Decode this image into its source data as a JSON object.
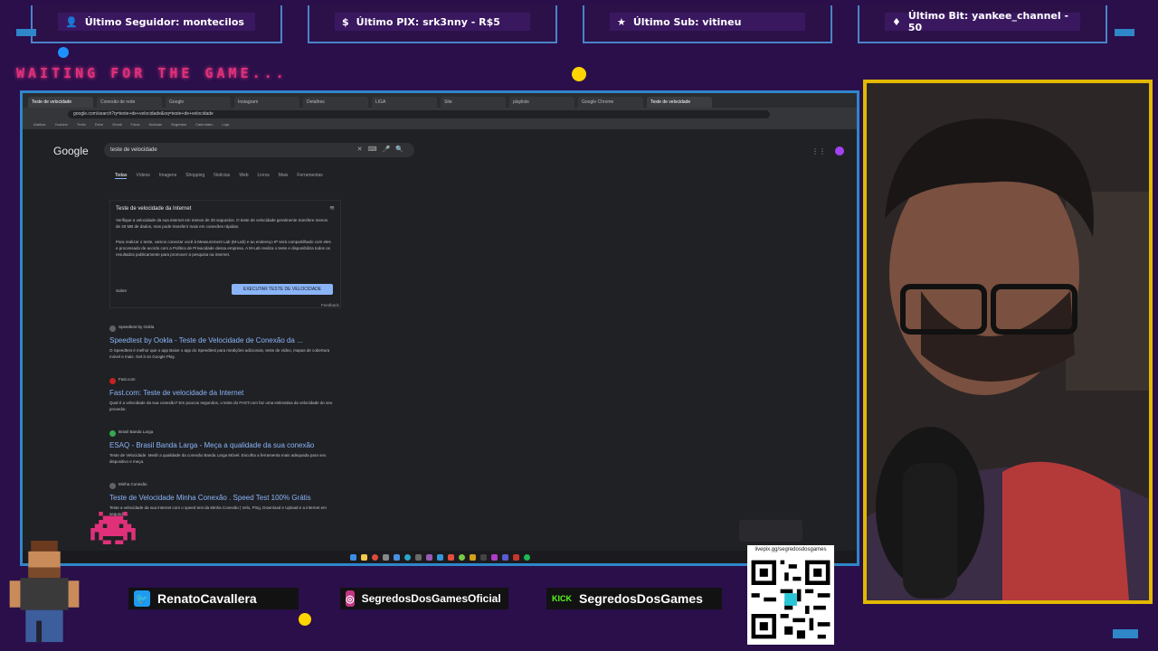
{
  "top_bars": [
    {
      "icon": "user-icon",
      "text": "Último Seguidor: montecilos"
    },
    {
      "icon": "dollar-icon",
      "text": "Último PIX: srk3nny - R$5"
    },
    {
      "icon": "star-icon",
      "text": "Último Sub: vitineu"
    },
    {
      "icon": "diamond-icon",
      "text": "Último Bit: yankee_channel - 50"
    }
  ],
  "overlay_text": "WAITING FOR THE GAME...",
  "browser": {
    "tabs": [
      "Teste de velocidade",
      "Conexão de rede",
      "Google",
      "Instagram",
      "Detalhes",
      "LIGA",
      "Site",
      "playlists",
      "Google Chrome",
      "Teste de velocidade"
    ],
    "url": "google.com/search?q=teste+de+velocidade&oq=teste+de+velocidade",
    "bookmarks": [
      "Atalhos",
      "Youtube",
      "Trello",
      "Drive",
      "Gmail",
      "Fotos",
      "Notícias",
      "Segredos",
      "Calendário",
      "Loja"
    ],
    "google_logo": "Google",
    "query": "teste de velocidade",
    "filters": [
      "Todas",
      "Vídeos",
      "Imagens",
      "Shopping",
      "Notícias",
      "Web",
      "Livros",
      "Mais",
      "Ferramentas"
    ],
    "speedtest": {
      "title": "Teste de velocidade da Internet",
      "p1": "Verifique a velocidade da sua internet em menos de 30 segundos. O teste de velocidade geralmente transfere menos de 40 MB de dados, mas pode transferir mais em conexões rápidas.",
      "p2": "Para realizar o teste, vamos conectar você à Measurement Lab (M-Lab) e ao endereço IP será compartilhado com eles e processado de acordo com a Política de Privacidade dessa empresa. A M-Lab realiza o teste e disponibiliza todos os resultados publicamente para promover a pesquisa na internet.",
      "about": "Sobre",
      "button": "EXECUTAR TESTE DE VELOCIDADE",
      "feedback": "Feedback"
    },
    "results": [
      {
        "site": "Speedtest by Ookla",
        "title": "Speedtest by Ookla - Teste de Velocidade de Conexão da ...",
        "snippet": "O Speedtest é melhor que o app Baixe o app do Speedtest para medições adicionais, teste de vídeo, mapas de cobertura móvel e mais. Get it on Google Play."
      },
      {
        "site": "Fast.com",
        "title": "Fast.com: Teste de velocidade da Internet",
        "snippet": "Qual é a velocidade da sua conexão? Em poucos segundos, o teste do FAST.com faz uma estimativa da velocidade do seu provedor."
      },
      {
        "site": "Brasil Banda Larga",
        "title": "ESAQ - Brasil Banda Larga - Meça a qualidade da sua conexão",
        "snippet": "Teste de Velocidade. Medir a qualidade da conexão Banda Larga Móvel. Escolha a ferramenta mais adequada para seu dispositivo e meça."
      },
      {
        "site": "Minha Conexão",
        "title": "Teste de Velocidade Minha Conexão . Speed Test 100% Grátis",
        "snippet": "Teste a velocidade da sua internet com o speed test da Minha Conexão | Velo, Ping, Download e Upload e a internet em segundos."
      }
    ]
  },
  "social": [
    {
      "icon": "twitter-icon",
      "text": "RenatoCavallera"
    },
    {
      "icon": "instagram-icon",
      "text": "SegredosDosGamesOficial"
    },
    {
      "icon": "kick-icon",
      "badge": "KICK",
      "text": "SegredosDosGames"
    }
  ],
  "qr_label": "livepix.gg/segredosdosgames",
  "colors": {
    "accent_blue": "#2f86c9",
    "cam_border": "#e2b800",
    "background": "#2a0f4a",
    "pink": "#e0307a"
  }
}
